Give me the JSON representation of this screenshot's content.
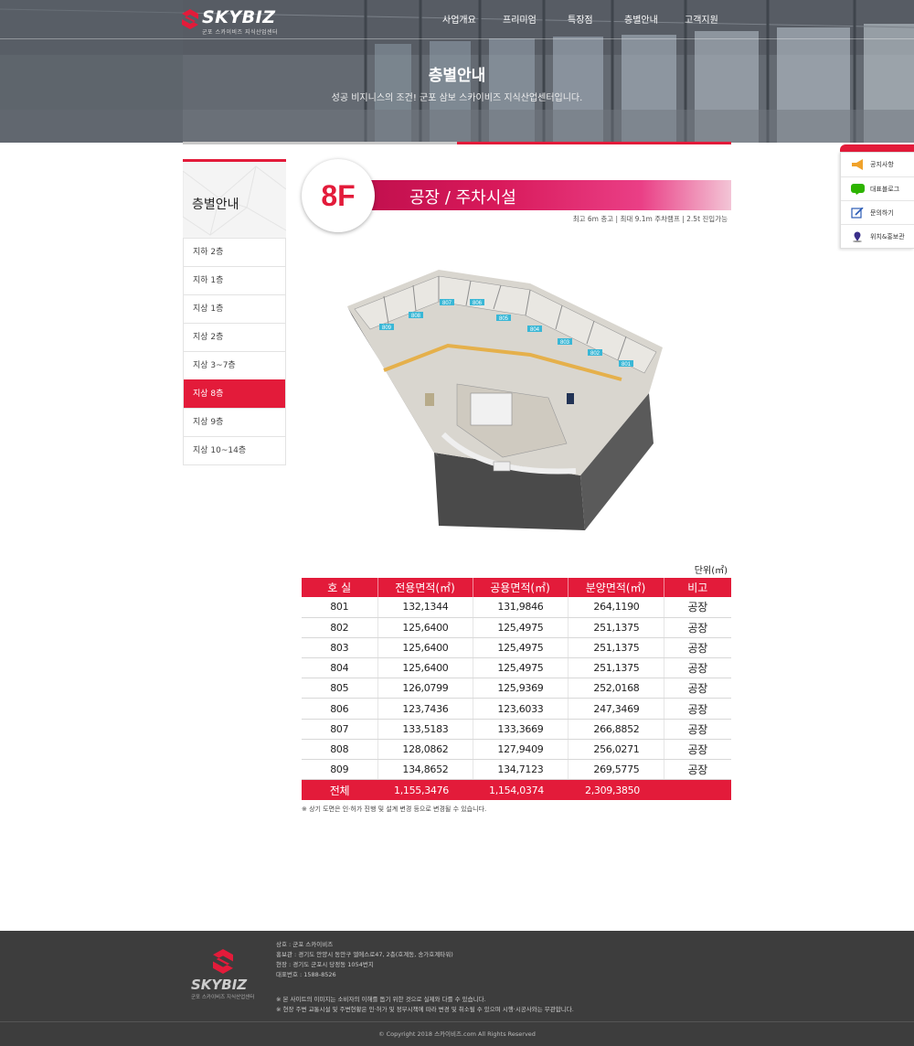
{
  "header": {
    "logo_text": "SKYBIZ",
    "logo_sub": "군포 스카이비즈 지식산업센터",
    "nav": [
      "사업개요",
      "프리미엄",
      "특장점",
      "층별안내",
      "고객지원"
    ],
    "title": "층별안내",
    "subtitle": "성공 비지니스의 조건! 군포 삼보 스카이비즈 지식산업센터입니다."
  },
  "sidebar": {
    "title": "층별안내",
    "items": [
      {
        "label": "지하 2층",
        "active": false
      },
      {
        "label": "지하 1층",
        "active": false
      },
      {
        "label": "지상 1층",
        "active": false
      },
      {
        "label": "지상 2층",
        "active": false
      },
      {
        "label": "지상 3~7층",
        "active": false
      },
      {
        "label": "지상 8층",
        "active": true
      },
      {
        "label": "지상 9층",
        "active": false
      },
      {
        "label": "지상 10~14층",
        "active": false
      }
    ]
  },
  "floor": {
    "badge": "8F",
    "title": "공장 / 주차시설",
    "note": "최고 6m 층고  |  최대 9.1m 주차램프  |  2.5t 진입가능",
    "plan_units": [
      "801",
      "802",
      "803",
      "804",
      "805",
      "806",
      "807",
      "808",
      "809"
    ]
  },
  "quick_menu": {
    "items": [
      {
        "label": "공지사항",
        "icon": "megaphone-icon"
      },
      {
        "label": "대표블로그",
        "icon": "blog-icon"
      },
      {
        "label": "문의하기",
        "icon": "pencil-icon"
      },
      {
        "label": "위치&홍보관",
        "icon": "map-pin-icon"
      }
    ]
  },
  "table": {
    "unit": "단위(㎡)",
    "headers": [
      "호 실",
      "전용면적(㎡)",
      "공용면적(㎡)",
      "분양면적(㎡)",
      "비고"
    ],
    "rows": [
      [
        "801",
        "132,1344",
        "131,9846",
        "264,1190",
        "공장"
      ],
      [
        "802",
        "125,6400",
        "125,4975",
        "251,1375",
        "공장"
      ],
      [
        "803",
        "125,6400",
        "125,4975",
        "251,1375",
        "공장"
      ],
      [
        "804",
        "125,6400",
        "125,4975",
        "251,1375",
        "공장"
      ],
      [
        "805",
        "126,0799",
        "125,9369",
        "252,0168",
        "공장"
      ],
      [
        "806",
        "123,7436",
        "123,6033",
        "247,3469",
        "공장"
      ],
      [
        "807",
        "133,5183",
        "133,3669",
        "266,8852",
        "공장"
      ],
      [
        "808",
        "128,0862",
        "127,9409",
        "256,0271",
        "공장"
      ],
      [
        "809",
        "134,8652",
        "134,7123",
        "269,5775",
        "공장"
      ]
    ],
    "total": [
      "전체",
      "1,155,3476",
      "1,154,0374",
      "2,309,3850",
      ""
    ],
    "note": "※ 상기 도면은 인·허가 진행 및 설계 변경 등으로 변경될 수 있습니다."
  },
  "footer": {
    "logo_text": "SKYBIZ",
    "logo_sub": "군포 스카이비즈 지식산업센터",
    "lines": [
      "상호 : 군포 스카이비즈",
      "홍보관 : 경기도 안양시 동안구 엘에스로47, 2층(호계동, 송가호계타워)",
      "현장 : 경기도 군포시 당정동 1054번지",
      "대표번호 : 1588-8526"
    ],
    "notes": [
      "※ 본 사이트의 이미지는 소비자의 이해를 돕기 위한 것으로 실제와 다를 수 있습니다.",
      "※ 현장 주변 교통시설 및 주변현황은 인·허가 및 정부시책에 따라 변경 및 취소될 수 있으며 시행·시공사와는 무관합니다."
    ],
    "copyright": "© Copyright 2018 스카이비즈.com All Rights Reserved"
  },
  "colors": {
    "accent": "#e31b3a",
    "footer_bg": "#3d3d3d",
    "floor_bar": "#d8195a"
  }
}
